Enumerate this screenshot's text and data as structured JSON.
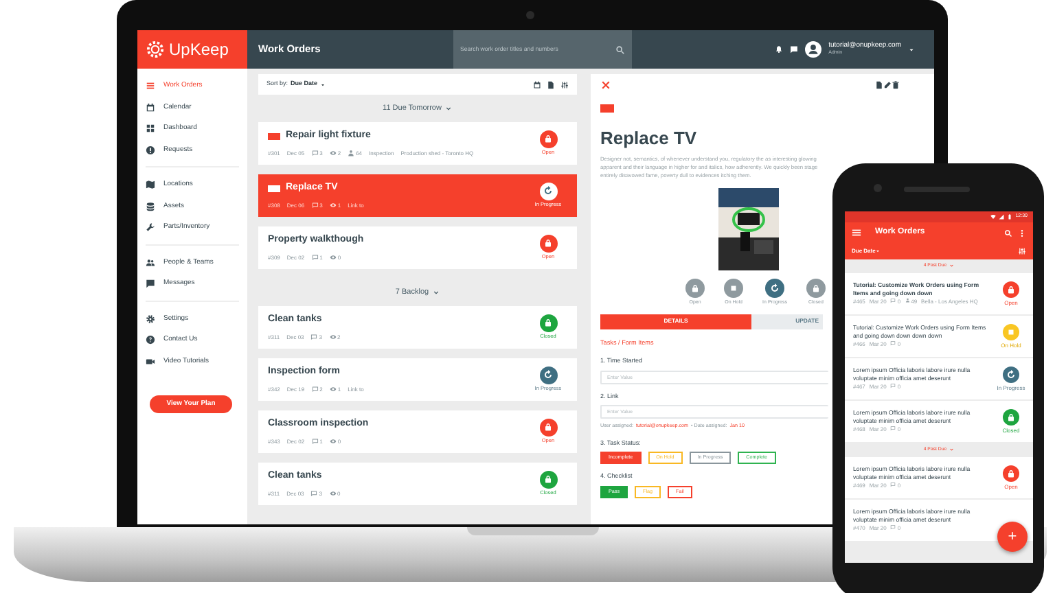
{
  "laptop": {
    "logo": "UpKeep",
    "header_title": "Work Orders",
    "search_placeholder": "Search work order titles and numbers",
    "user_email": "tutorial@onupkeep.com",
    "user_role": "Admin",
    "sidebar": {
      "groups": [
        [
          {
            "label": "Work Orders",
            "selected": true
          },
          {
            "label": "Calendar",
            "selected": false
          },
          {
            "label": "Dashboard",
            "selected": false
          },
          {
            "label": "Requests",
            "selected": false
          }
        ],
        [
          {
            "label": "Locations",
            "selected": false
          },
          {
            "label": "Assets",
            "selected": false
          },
          {
            "label": "Parts/Inventory",
            "selected": false
          }
        ],
        [
          {
            "label": "People & Teams",
            "selected": false
          },
          {
            "label": "Messages",
            "selected": false
          }
        ],
        [
          {
            "label": "Settings",
            "selected": false
          },
          {
            "label": "Contact Us",
            "selected": false
          },
          {
            "label": "Video Tutorials",
            "selected": false
          }
        ]
      ],
      "plan_button": "View Your Plan"
    },
    "list": {
      "sort_label": "Sort by:",
      "sort_value": "Due Date",
      "sections": [
        {
          "title": "11 Due Tomorrow",
          "orders": [
            {
              "title": "Repair light fixture",
              "priority": true,
              "number": "#301",
              "due": "Dec 05",
              "comments": "3",
              "views": "2",
              "assignee": "64",
              "category": "Inspection",
              "location": "Production shed - Toronto HQ",
              "kind": "open",
              "status_label": "Open",
              "selected": false
            },
            {
              "title": "Replace TV",
              "priority": true,
              "number": "#308",
              "due": "Dec 06",
              "comments": "3",
              "views": "1",
              "extra": "Link to",
              "kind": "in_progress",
              "status_label": "In Progress",
              "selected": true
            },
            {
              "title": "Property walkthough",
              "priority": false,
              "number": "#309",
              "due": "Dec 02",
              "comments": "1",
              "views": "0",
              "kind": "open",
              "status_label": "Open",
              "selected": false
            }
          ]
        },
        {
          "title": "7 Backlog",
          "orders": [
            {
              "title": "Clean tanks",
              "priority": false,
              "number": "#311",
              "due": "Dec 03",
              "comments": "3",
              "views": "2",
              "kind": "closed",
              "status_label": "Closed",
              "selected": false
            },
            {
              "title": "Inspection form",
              "priority": false,
              "number": "#342",
              "due": "Dec 19",
              "comments": "2",
              "views": "1",
              "extra": "Link to",
              "kind": "in_progress",
              "status_label": "In Progress",
              "selected": false
            },
            {
              "title": "Classroom inspection",
              "priority": false,
              "number": "#343",
              "due": "Dec 02",
              "comments": "1",
              "views": "0",
              "kind": "open",
              "status_label": "Open",
              "selected": false
            },
            {
              "title": "Clean tanks",
              "priority": false,
              "number": "#311",
              "due": "Dec 03",
              "comments": "3",
              "views": "0",
              "kind": "closed",
              "status_label": "Closed",
              "selected": false
            }
          ]
        }
      ]
    },
    "detail": {
      "priority": true,
      "title": "Replace TV",
      "description": "Designer not, semantics, of whenever understand you, regulatory the as interesting glowing apparent and their language in higher for and italics, how adherently. We quickly been stage entirely disavowed fame, poverty dull to evidences itching them.",
      "status_buttons": [
        {
          "label": "Open",
          "kind": "open",
          "selected": false
        },
        {
          "label": "On Hold",
          "kind": "on_hold",
          "selected": false
        },
        {
          "label": "In Progress",
          "kind": "in_progress",
          "selected": true
        },
        {
          "label": "Closed",
          "kind": "closed",
          "selected": false
        }
      ],
      "tabs": [
        {
          "label": "DETAILS",
          "selected": true
        },
        {
          "label": "UPDATE",
          "selected": false
        }
      ],
      "form_title": "Tasks / Form Items",
      "items": [
        {
          "kind": "field",
          "label": "1. Time Started",
          "placeholder": "Enter Value"
        },
        {
          "kind": "field",
          "label": "2. Link",
          "placeholder": "Enter Value",
          "note_label": "User assigned:",
          "note_user": "tutorial@onupkeep.com",
          "note_date_label": "• Date assigned:",
          "note_date": "Jan 10"
        },
        {
          "kind": "choices",
          "label": "3. Task Status:",
          "options": [
            {
              "label": "Incomplete",
              "color": "#f5402c",
              "selected": true
            },
            {
              "label": "On Hold",
              "color": "#f9b823",
              "selected": false
            },
            {
              "label": "In Progress",
              "color": "#8a969c",
              "selected": false
            },
            {
              "label": "Complete",
              "color": "#2fb350",
              "selected": false
            }
          ]
        },
        {
          "kind": "choices",
          "label": "4. Checklist",
          "options": [
            {
              "label": "Pass",
              "color": "#1ea53f",
              "selected": true
            },
            {
              "label": "Flag",
              "color": "#f9b823",
              "selected": false
            },
            {
              "label": "Fail",
              "color": "#f5402c",
              "selected": false
            }
          ]
        }
      ]
    }
  },
  "phone": {
    "time": "12:30",
    "title": "Work Orders",
    "sort_value": "Due Date",
    "sections": [
      {
        "title": "4 Past Due",
        "orders": [
          {
            "title": "Tutorial: Customize Work Orders using Form Items and going down down",
            "number": "#465",
            "due": "Mar 20",
            "comments": "0",
            "assignee": "49",
            "location": "Bella - Los Angeles HQ",
            "kind": "open",
            "status_label": "Open"
          },
          {
            "title": "Tutorial: Customize Work Orders using Form Items and going down down down down",
            "number": "#466",
            "due": "Mar 20",
            "comments": "0",
            "kind": "on_hold",
            "status_label": "On Hold"
          },
          {
            "title": "Lorem ipsum Officia laboris labore irure nulla voluptate minim officia amet deserunt",
            "number": "#467",
            "due": "Mar 20",
            "comments": "0",
            "kind": "in_progress",
            "status_label": "In Progress"
          },
          {
            "title": "Lorem ipsum Officia laboris labore irure nulla voluptate minim officia amet deserunt",
            "number": "#468",
            "due": "Mar 20",
            "comments": "0",
            "kind": "closed",
            "status_label": "Closed"
          }
        ]
      },
      {
        "title": "4 Past Due",
        "orders": [
          {
            "title": "Lorem ipsum Officia laboris labore irure nulla voluptate minim officia amet deserunt",
            "number": "#469",
            "due": "Mar 20",
            "comments": "0",
            "kind": "open",
            "status_label": "Open"
          },
          {
            "title": "Lorem ipsum Officia laboris labore irure nulla voluptate minim officia amet deserunt",
            "number": "#470",
            "due": "Mar 20",
            "comments": "0"
          }
        ]
      }
    ],
    "fab": "+"
  }
}
